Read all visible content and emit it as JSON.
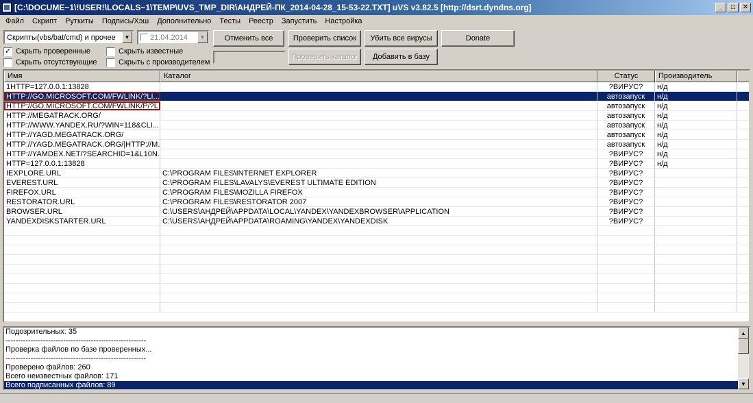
{
  "window": {
    "title": "[C:\\DOCUME~1\\!USER!\\LOCALS~1\\TEMP\\UVS_TMP_DIR\\АНДРЕЙ-ПК_2014-04-28_15-53-22.TXT] uVS v3.82.5 [http://dsrt.dyndns.org]",
    "minimize": "_",
    "maximize": "□",
    "close": "✕"
  },
  "menu": [
    "Файл",
    "Скрипт",
    "Руткиты",
    "Подпись/Хэш",
    "Дополнительно",
    "Тесты",
    "Реестр",
    "Запустить",
    "Настройка"
  ],
  "toolbar": {
    "filter_combo": "Скрипты(vbs/bat/cmd) и прочее",
    "date_combo": "21.04.2014",
    "cancel_all": "Отменить все",
    "check_list": "Проверить список",
    "kill_all": "Убить все вирусы",
    "donate": "Donate",
    "check_catalog": "Проверить каталог",
    "add_to_base": "Добавить в базу"
  },
  "checkboxes": {
    "hide_checked": {
      "label": "Скрыть проверенные",
      "checked": true
    },
    "hide_known": {
      "label": "Скрыть известные",
      "checked": false
    },
    "hide_missing": {
      "label": "Скрыть отсутствующие",
      "checked": false
    },
    "hide_with_vendor": {
      "label": "Скрыть с производителем",
      "checked": false
    }
  },
  "table": {
    "headers": [
      "Имя",
      "Каталог",
      "Статус",
      "Производитель"
    ],
    "rows": [
      {
        "name": "1HTTP=127.0.0.1:13828",
        "catalog": "",
        "status": "?ВИРУС?",
        "vendor": "н/д"
      },
      {
        "name": "HTTP://GO.MICROSOFT.COM/FWLINK/?LI...",
        "catalog": "",
        "status": "автозапуск",
        "vendor": "н/д"
      },
      {
        "name": "HTTP://GO.MICROSOFT.COM/FWLINK/P/?L...",
        "catalog": "",
        "status": "автозапуск",
        "vendor": "н/д"
      },
      {
        "name": "HTTP://MEGATRACK.ORG/",
        "catalog": "",
        "status": "автозапуск",
        "vendor": "н/д"
      },
      {
        "name": "HTTP://WWW.YANDEX.RU/?WIN=118&CLI...",
        "catalog": "",
        "status": "автозапуск",
        "vendor": "н/д"
      },
      {
        "name": "HTTP://YAGD.MEGATRACK.ORG/",
        "catalog": "",
        "status": "автозапуск",
        "vendor": "н/д"
      },
      {
        "name": "HTTP://YAGD.MEGATRACK.ORG/|HTTP://M...",
        "catalog": "",
        "status": "автозапуск",
        "vendor": "н/д"
      },
      {
        "name": "HTTP://YAMDEX.NET/?SEARCHID=1&L10N...",
        "catalog": "",
        "status": "?ВИРУС?",
        "vendor": "н/д"
      },
      {
        "name": "HTTP=127.0.0.1:13828",
        "catalog": "",
        "status": "?ВИРУС?",
        "vendor": "н/д"
      },
      {
        "name": "IEXPLORE.URL",
        "catalog": "C:\\PROGRAM FILES\\INTERNET EXPLORER",
        "status": "?ВИРУС?",
        "vendor": ""
      },
      {
        "name": "EVEREST.URL",
        "catalog": "C:\\PROGRAM FILES\\LAVALYS\\EVEREST ULTIMATE EDITION",
        "status": "?ВИРУС?",
        "vendor": ""
      },
      {
        "name": "FIREFOX.URL",
        "catalog": "C:\\PROGRAM FILES\\MOZILLA FIREFOX",
        "status": "?ВИРУС?",
        "vendor": ""
      },
      {
        "name": "RESTORATOR.URL",
        "catalog": "C:\\PROGRAM FILES\\RESTORATOR 2007",
        "status": "?ВИРУС?",
        "vendor": ""
      },
      {
        "name": "BROWSER.URL",
        "catalog": "C:\\USERS\\АНДРЕЙ\\APPDATA\\LOCAL\\YANDEX\\YANDEXBROWSER\\APPLICATION",
        "status": "?ВИРУС?",
        "vendor": ""
      },
      {
        "name": "YANDEXDISKSTARTER.URL",
        "catalog": "C:\\USERS\\АНДРЕЙ\\APPDATA\\ROAMING\\YANDEX\\YANDEXDISK",
        "status": "?ВИРУС?",
        "vendor": ""
      }
    ],
    "selected_row": 1
  },
  "log": [
    "Подозрительных: 35",
    "--------------------------------------------------------",
    "Проверка файлов по базе проверенных...",
    "--------------------------------------------------------",
    "Проверено файлов: 260",
    "Всего неизвестных файлов: 171",
    "Всего подписанных файлов: 89"
  ],
  "log_selected": 6
}
